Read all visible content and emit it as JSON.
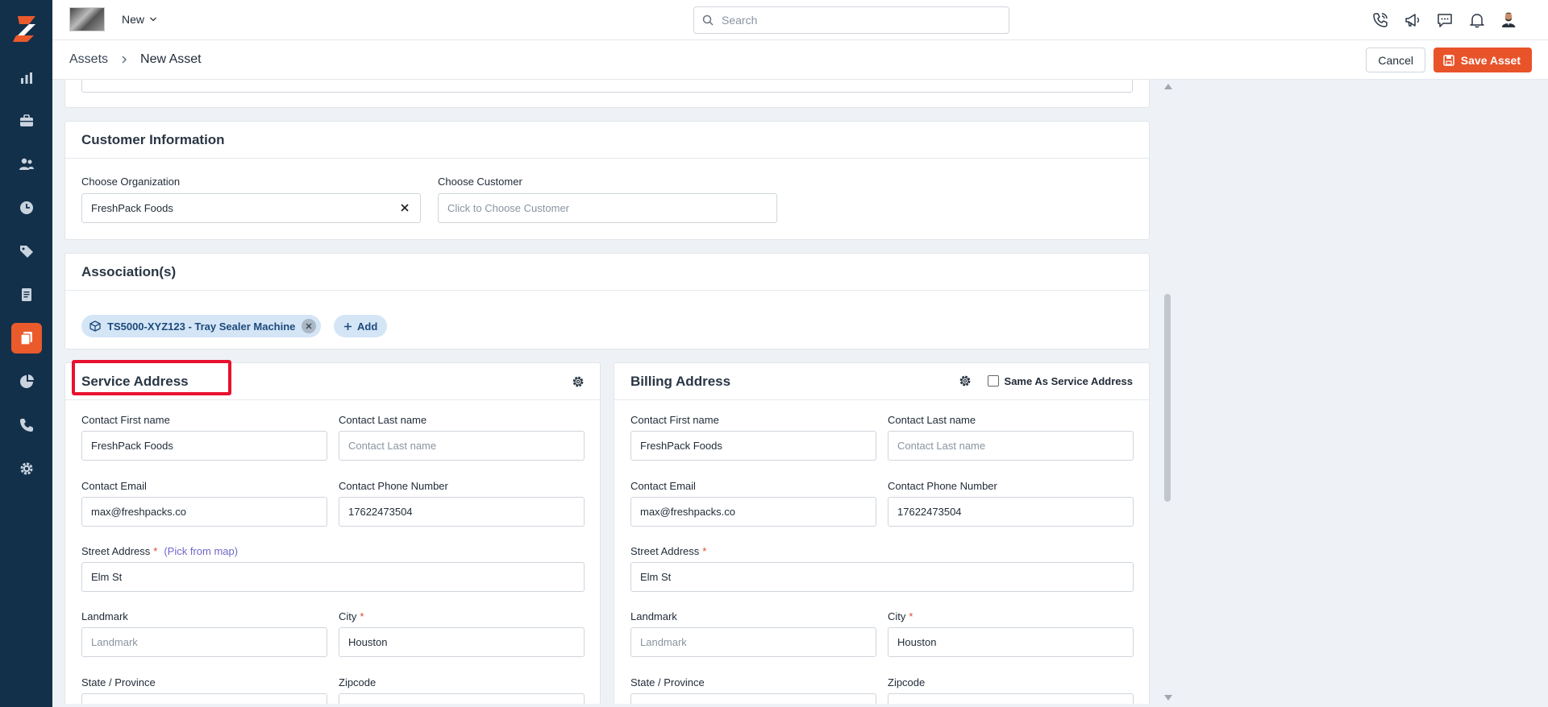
{
  "topbar": {
    "new_label": "New",
    "search_placeholder": "Search"
  },
  "breadcrumb": {
    "parent": "Assets",
    "separator": ">",
    "current": "New Asset"
  },
  "actions": {
    "cancel_label": "Cancel",
    "save_label": "Save Asset"
  },
  "customer_info": {
    "title": "Customer Information",
    "org_label": "Choose Organization",
    "org_value": "FreshPack Foods",
    "customer_label": "Choose Customer",
    "customer_placeholder": "Click to Choose Customer"
  },
  "associations": {
    "title": "Association(s)",
    "chip_label": "TS5000-XYZ123 - Tray Sealer Machine",
    "add_label": "Add"
  },
  "service_address": {
    "title": "Service Address",
    "first_name_label": "Contact First name",
    "first_name_value": "FreshPack Foods",
    "last_name_label": "Contact Last name",
    "last_name_placeholder": "Contact Last name",
    "email_label": "Contact Email",
    "email_value": "max@freshpacks.co",
    "phone_label": "Contact Phone Number",
    "phone_value": "17622473504",
    "street_label": "Street Address",
    "street_required": "*",
    "pick_from_map": "(Pick from map)",
    "street_value": "Elm St",
    "landmark_label": "Landmark",
    "landmark_placeholder": "Landmark",
    "city_label": "City",
    "city_required": "*",
    "city_value": "Houston",
    "state_label": "State / Province",
    "zip_label": "Zipcode"
  },
  "billing_address": {
    "title": "Billing Address",
    "same_as_label": "Same As Service Address",
    "first_name_label": "Contact First name",
    "first_name_value": "FreshPack Foods",
    "last_name_label": "Contact Last name",
    "last_name_placeholder": "Contact Last name",
    "email_label": "Contact Email",
    "email_value": "max@freshpacks.co",
    "phone_label": "Contact Phone Number",
    "phone_value": "17622473504",
    "street_label": "Street Address",
    "street_required": "*",
    "street_value": "Elm St",
    "landmark_label": "Landmark",
    "landmark_placeholder": "Landmark",
    "city_label": "City",
    "city_required": "*",
    "city_value": "Houston",
    "state_label": "State / Province",
    "zip_label": "Zipcode"
  },
  "colors": {
    "sidebar_bg": "#13304b",
    "accent": "#e8532a",
    "highlight": "#e8112d"
  }
}
